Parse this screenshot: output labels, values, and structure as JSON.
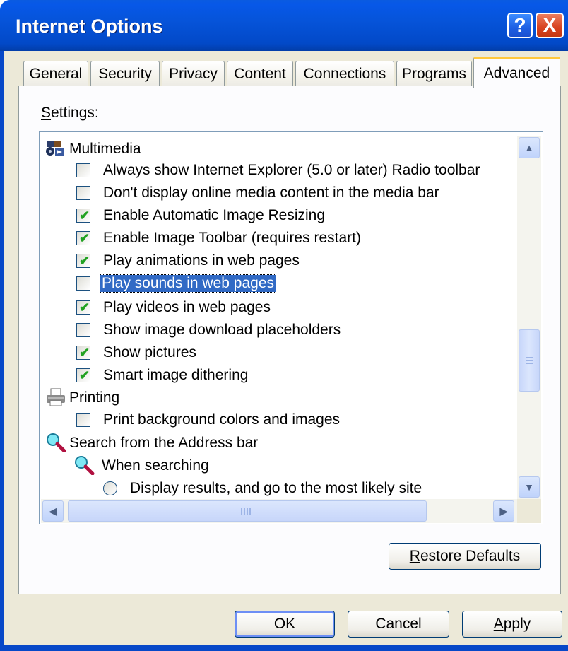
{
  "window": {
    "title": "Internet Options",
    "help_glyph": "?",
    "close_glyph": "X"
  },
  "tabs": [
    {
      "label": "General"
    },
    {
      "label": "Security"
    },
    {
      "label": "Privacy"
    },
    {
      "label": "Content"
    },
    {
      "label": "Connections"
    },
    {
      "label": "Programs"
    },
    {
      "label": "Advanced",
      "active": true
    }
  ],
  "settings_label": {
    "underlined": "S",
    "rest": "ettings:"
  },
  "settings": [
    {
      "kind": "category",
      "icon": "multimedia-icon",
      "label": "Multimedia"
    },
    {
      "kind": "checkbox",
      "checked": false,
      "label": "Always show Internet Explorer (5.0 or later) Radio toolbar"
    },
    {
      "kind": "checkbox",
      "checked": false,
      "label": "Don't display online media content in the media bar"
    },
    {
      "kind": "checkbox",
      "checked": true,
      "label": "Enable Automatic Image Resizing"
    },
    {
      "kind": "checkbox",
      "checked": true,
      "label": "Enable Image Toolbar (requires restart)"
    },
    {
      "kind": "checkbox",
      "checked": true,
      "label": "Play animations in web pages"
    },
    {
      "kind": "checkbox",
      "checked": false,
      "selected": true,
      "label": "Play sounds in web pages"
    },
    {
      "kind": "checkbox",
      "checked": true,
      "label": "Play videos in web pages"
    },
    {
      "kind": "checkbox",
      "checked": false,
      "label": "Show image download placeholders"
    },
    {
      "kind": "checkbox",
      "checked": true,
      "label": "Show pictures"
    },
    {
      "kind": "checkbox",
      "checked": true,
      "label": "Smart image dithering"
    },
    {
      "kind": "category",
      "icon": "printer-icon",
      "label": "Printing"
    },
    {
      "kind": "checkbox",
      "checked": false,
      "label": "Print background colors and images"
    },
    {
      "kind": "category",
      "icon": "magnifier-icon",
      "label": "Search from the Address bar"
    },
    {
      "kind": "subcategory",
      "icon": "magnifier-icon",
      "label": "When searching"
    },
    {
      "kind": "radio",
      "checked": false,
      "label": "Display results, and go to the most likely site"
    }
  ],
  "buttons": {
    "restore_defaults": {
      "underlined": "R",
      "rest": "estore Defaults"
    },
    "ok": "OK",
    "cancel": "Cancel",
    "apply": {
      "underlined": "A",
      "rest": "pply"
    }
  },
  "colors": {
    "titlebar": "#0654da",
    "dialog_bg": "#ece9d8",
    "selection": "#316ac5",
    "check_green": "#21a121",
    "active_tab_accent": "#ffc83c"
  }
}
